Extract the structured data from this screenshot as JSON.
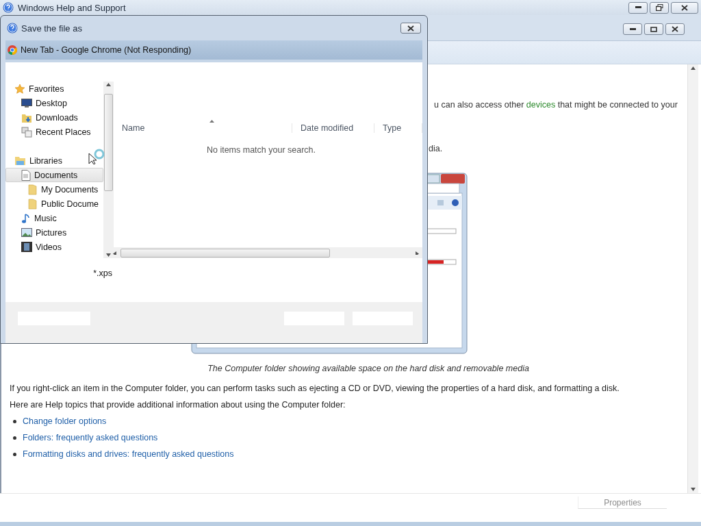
{
  "help_window": {
    "title": "Windows Help and Support"
  },
  "article": {
    "intro_before": "u can also access other",
    "intro_link": "devices",
    "intro_after": "that might be connected to your",
    "fragment": "dia.",
    "caption": "The Computer folder showing available space on the hard disk and removable media",
    "paragraphs": [
      "If you right-click an item in the Computer folder, you can perform tasks such as ejecting a CD or DVD, viewing the properties of a hard disk, and formatting a disk.",
      "Here are Help topics that provide additional information about using the Computer folder:"
    ],
    "links": [
      "Change folder options",
      "Folders: frequently asked questions",
      "Formatting disks and drives: frequently asked questions"
    ],
    "properties_button": "Properties"
  },
  "save_dialog": {
    "title": "Save the file as",
    "background_window_title": "New Tab - Google Chrome (Not Responding)",
    "tree": [
      {
        "label": "Favorites",
        "selected": false,
        "children": [
          {
            "label": "Desktop",
            "selected": false
          },
          {
            "label": "Downloads",
            "selected": false
          },
          {
            "label": "Recent Places",
            "selected": false
          }
        ]
      },
      {
        "label": "Libraries",
        "selected": false,
        "children": [
          {
            "label": "Documents",
            "selected": true,
            "children": [
              {
                "label": "My Documents",
                "selected": false
              },
              {
                "label": "Public Docume",
                "selected": false
              }
            ]
          },
          {
            "label": "Music",
            "selected": false
          },
          {
            "label": "Pictures",
            "selected": false
          },
          {
            "label": "Videos",
            "selected": false
          }
        ]
      }
    ],
    "columns": [
      "Name",
      "Date modified",
      "Type"
    ],
    "empty_message": "No items match your search.",
    "file_type": "*.xps"
  }
}
